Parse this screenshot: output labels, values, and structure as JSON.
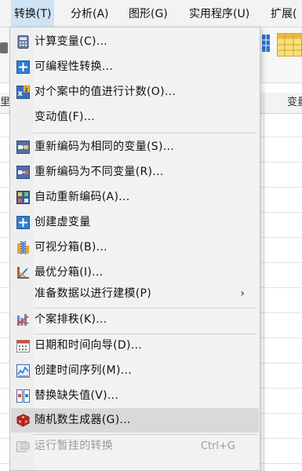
{
  "menubar": {
    "items": [
      {
        "label": "转换(T)",
        "key": "transform"
      },
      {
        "label": "分析(A)",
        "key": "analyze"
      },
      {
        "label": "图形(G)",
        "key": "graphs"
      },
      {
        "label": "实用程序(U)",
        "key": "utilities"
      },
      {
        "label": "扩展(",
        "key": "extensions"
      }
    ]
  },
  "background": {
    "row_header_partial": "里",
    "column_partial": "变量"
  },
  "menu": {
    "items": [
      {
        "label": "计算变量(C)...",
        "icon": "calculator-icon"
      },
      {
        "label": "可编程性转换...",
        "icon": "plus-icon"
      },
      {
        "label": "对个案中的值进行计数(O)...",
        "icon": "count-values-icon"
      },
      {
        "label": "变动值(F)...",
        "icon": ""
      },
      {
        "label": "重新编码为相同的变量(S)...",
        "icon": "recode-same-icon"
      },
      {
        "label": "重新编码为不同变量(R)...",
        "icon": "recode-different-icon"
      },
      {
        "label": "自动重新编码(A)...",
        "icon": "auto-recode-icon"
      },
      {
        "label": "创建虚变量",
        "icon": "plus-icon"
      },
      {
        "label": "可视分箱(B)...",
        "icon": "visual-binning-icon"
      },
      {
        "label": "最优分箱(I)...",
        "icon": "optimal-binning-icon"
      },
      {
        "label": "准备数据以进行建模(P)",
        "icon": "",
        "submenu": true
      },
      {
        "label": "个案排秩(K)...",
        "icon": "rank-cases-icon"
      },
      {
        "label": "日期和时间向导(D)...",
        "icon": "calendar-icon"
      },
      {
        "label": "创建时间序列(M)...",
        "icon": "time-series-icon"
      },
      {
        "label": "替换缺失值(V)...",
        "icon": "replace-missing-icon"
      },
      {
        "label": "随机数生成器(G)...",
        "icon": "dice-icon"
      },
      {
        "label": "运行暂挂的转换",
        "icon": "run-pending-icon",
        "shortcut": "Ctrl+G",
        "disabled": true
      }
    ],
    "submenu_arrow": "›"
  }
}
